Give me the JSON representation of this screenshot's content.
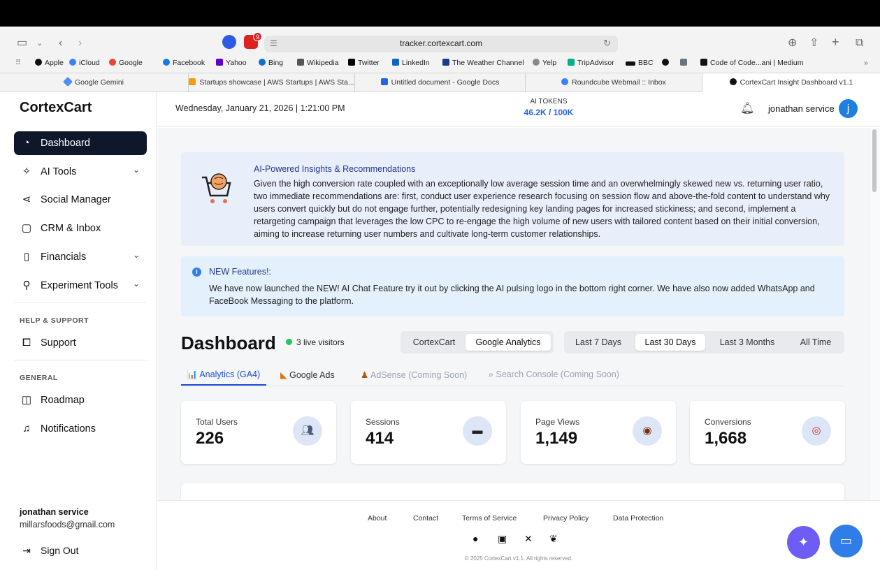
{
  "browser": {
    "url": "tracker.cortexcart.com",
    "ext_badge": "9",
    "bookmarks": [
      "Apple",
      "iCloud",
      "Google",
      "Facebook",
      "Yahoo",
      "Bing",
      "Wikipedia",
      "Twitter",
      "LinkedIn",
      "The Weather Channel",
      "Yelp",
      "TripAdvisor",
      "BBC",
      "Code of Code...ani | Medium"
    ],
    "tabs": [
      "Google Gemini",
      "Startups showcase | AWS Startups | AWS Sta...",
      "Untitled document - Google Docs",
      "Roundcube Webmail :: Inbox",
      "CortexCart Insight Dashboard v1.1"
    ]
  },
  "sidebar": {
    "brand": "CortexCart",
    "items": [
      {
        "label": "Dashboard"
      },
      {
        "label": "AI Tools"
      },
      {
        "label": "Social Manager"
      },
      {
        "label": "CRM & Inbox"
      },
      {
        "label": "Financials"
      },
      {
        "label": "Experiment Tools"
      }
    ],
    "help_label": "HELP & SUPPORT",
    "support": "Support",
    "general_label": "GENERAL",
    "roadmap": "Roadmap",
    "notifications": "Notifications",
    "user_name": "jonathan service",
    "user_email": "millarsfoods@gmail.com",
    "sign_out": "Sign Out"
  },
  "header": {
    "date": "Wednesday, January 21, 2026  |  1:21:00 PM",
    "tokens_label": "AI TOKENS",
    "tokens_value": "46.2K / 100K",
    "user": "jonathan service",
    "avatar": "j"
  },
  "insights": {
    "title": "AI-Powered Insights & Recommendations",
    "body": "Given the high conversion rate coupled with an exceptionally low average session time and an overwhelmingly skewed new vs. returning user ratio, two immediate recommendations are: first, conduct user experience research focusing on session flow and above-the-fold content to understand why users convert quickly but do not engage further, potentially redesigning key landing pages for increased stickiness; and second, implement a retargeting campaign that leverages the low CPC to re-engage the high volume of new users with tailored content based on their initial conversion, aiming to increase returning user numbers and cultivate long-term customer relationships."
  },
  "features": {
    "title": "NEW Features!:",
    "body": "We have now launched the NEW! AI Chat Feature try it out by clicking the AI pulsing logo in the bottom right corner. We have also now added WhatsApp and FaceBook Messaging to the platform."
  },
  "dashboard": {
    "title": "Dashboard",
    "live": "3 live visitors",
    "source_tabs": [
      "CortexCart",
      "Google Analytics"
    ],
    "range_tabs": [
      "Last 7 Days",
      "Last 30 Days",
      "Last 3 Months",
      "All Time"
    ],
    "sub_tabs": [
      "📊 Analytics (GA4)",
      "Google Ads",
      "AdSense (Coming Soon)",
      "Search Console (Coming Soon)"
    ],
    "cards": [
      {
        "label": "Total Users",
        "value": "226",
        "icon": "users-icon"
      },
      {
        "label": "Sessions",
        "value": "414",
        "icon": "laptop-icon"
      },
      {
        "label": "Page Views",
        "value": "1,149",
        "icon": "eye-icon"
      },
      {
        "label": "Conversions",
        "value": "1,668",
        "icon": "target-icon"
      }
    ]
  },
  "footer": {
    "links": [
      "About",
      "Contact",
      "Terms of Service",
      "Privacy Policy",
      "Data Protection"
    ],
    "copyright": "© 2025 CortexCart v1.1. All rights reserved."
  },
  "colors": {
    "accent": "#2563eb",
    "nav_active": "#0f172a",
    "live": "#22c55e",
    "fab_ai": "#6d5df5",
    "fab_chat": "#2f7de8"
  }
}
